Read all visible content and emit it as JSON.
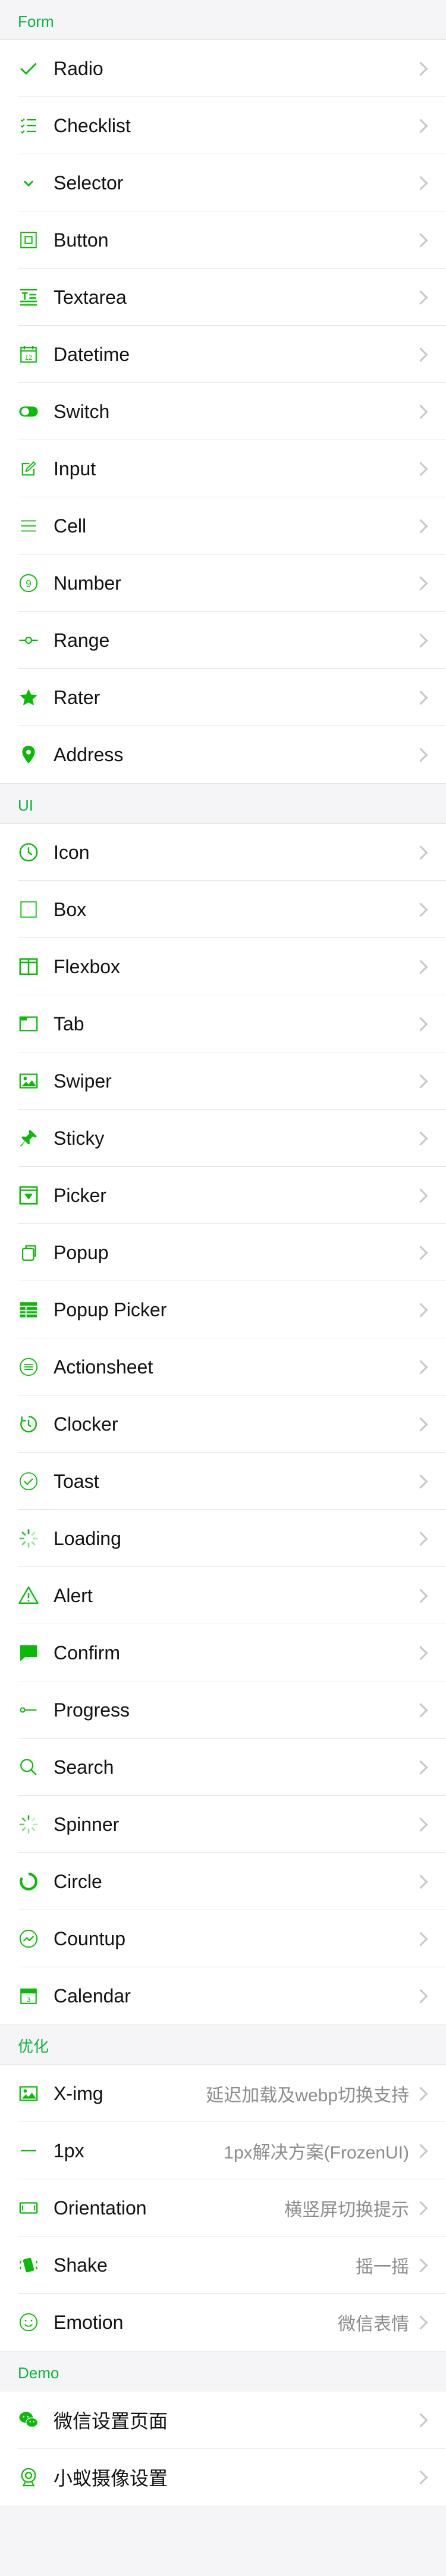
{
  "sections": [
    {
      "title": "Form",
      "items": [
        {
          "label": "Radio",
          "icon": "check-icon"
        },
        {
          "label": "Checklist",
          "icon": "checklist-icon"
        },
        {
          "label": "Selector",
          "icon": "chevron-down-icon"
        },
        {
          "label": "Button",
          "icon": "button-icon"
        },
        {
          "label": "Textarea",
          "icon": "textarea-icon"
        },
        {
          "label": "Datetime",
          "icon": "calendar-12-icon"
        },
        {
          "label": "Switch",
          "icon": "switch-icon"
        },
        {
          "label": "Input",
          "icon": "input-edit-icon"
        },
        {
          "label": "Cell",
          "icon": "cell-lines-icon"
        },
        {
          "label": "Number",
          "icon": "number-9-icon"
        },
        {
          "label": "Range",
          "icon": "range-slider-icon"
        },
        {
          "label": "Rater",
          "icon": "star-icon"
        },
        {
          "label": "Address",
          "icon": "location-pin-icon"
        }
      ]
    },
    {
      "title": "UI",
      "items": [
        {
          "label": "Icon",
          "icon": "clock-icon"
        },
        {
          "label": "Box",
          "icon": "box-icon"
        },
        {
          "label": "Flexbox",
          "icon": "flexbox-icon"
        },
        {
          "label": "Tab",
          "icon": "tab-icon"
        },
        {
          "label": "Swiper",
          "icon": "image-icon"
        },
        {
          "label": "Sticky",
          "icon": "pushpin-icon"
        },
        {
          "label": "Picker",
          "icon": "picker-icon"
        },
        {
          "label": "Popup",
          "icon": "popup-icon"
        },
        {
          "label": "Popup Picker",
          "icon": "table-icon"
        },
        {
          "label": "Actionsheet",
          "icon": "actionsheet-icon"
        },
        {
          "label": "Clocker",
          "icon": "timer-icon"
        },
        {
          "label": "Toast",
          "icon": "toast-check-icon"
        },
        {
          "label": "Loading",
          "icon": "loading-spinner-icon"
        },
        {
          "label": "Alert",
          "icon": "warning-icon"
        },
        {
          "label": "Confirm",
          "icon": "chat-bubble-icon"
        },
        {
          "label": "Progress",
          "icon": "progress-icon"
        },
        {
          "label": "Search",
          "icon": "search-icon"
        },
        {
          "label": "Spinner",
          "icon": "spinner-icon"
        },
        {
          "label": "Circle",
          "icon": "circle-progress-icon"
        },
        {
          "label": "Countup",
          "icon": "trend-circle-icon"
        },
        {
          "label": "Calendar",
          "icon": "calendar-icon"
        }
      ]
    },
    {
      "title": "优化",
      "items": [
        {
          "label": "X-img",
          "icon": "image-icon",
          "value": "延迟加载及webp切换支持"
        },
        {
          "label": "1px",
          "icon": "line-icon",
          "value": "1px解决方案(FrozenUI)"
        },
        {
          "label": "Orientation",
          "icon": "orientation-icon",
          "value": "横竖屏切换提示"
        },
        {
          "label": "Shake",
          "icon": "shake-icon",
          "value": "摇一摇"
        },
        {
          "label": "Emotion",
          "icon": "smile-icon",
          "value": "微信表情"
        }
      ]
    },
    {
      "title": "Demo",
      "items": [
        {
          "label": "微信设置页面",
          "icon": "wechat-icon"
        },
        {
          "label": "小蚁摄像设置",
          "icon": "camera-icon"
        }
      ]
    }
  ]
}
